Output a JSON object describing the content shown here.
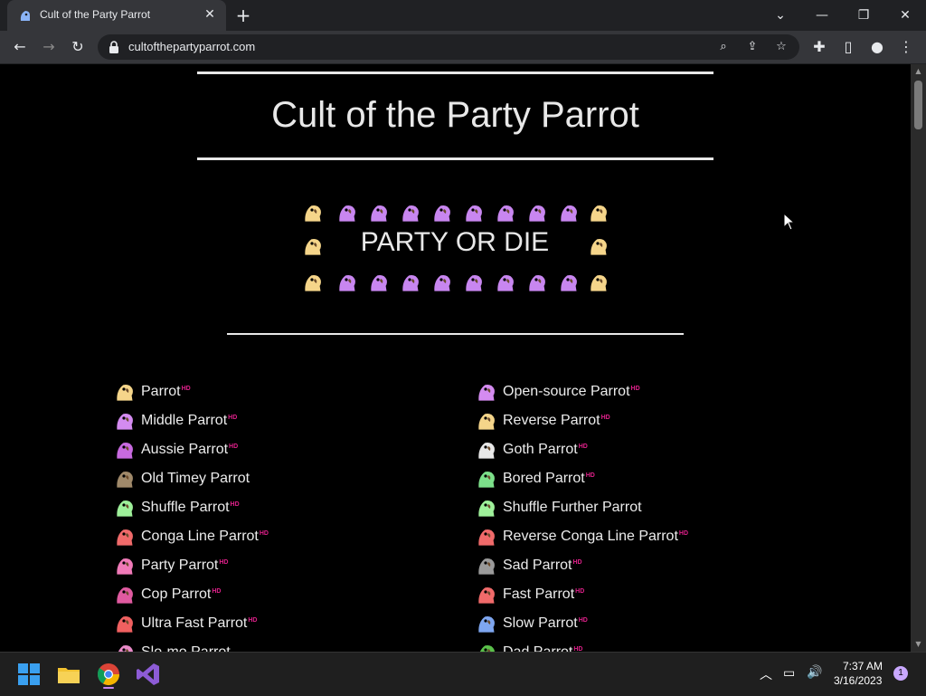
{
  "browser": {
    "tab_title": "Cult of the Party Parrot",
    "url": "cultofthepartyparrot.com"
  },
  "page": {
    "title": "Cult of the Party Parrot",
    "banner_text": "PARTY OR DIE",
    "hd_badge": "HD",
    "parrots_left": [
      {
        "label": "Parrot",
        "hd": true,
        "color": "#f5d58a"
      },
      {
        "label": "Middle Parrot",
        "hd": true,
        "color": "#d48bf0"
      },
      {
        "label": "Aussie Parrot",
        "hd": true,
        "color": "#c86ae0"
      },
      {
        "label": "Old Timey Parrot",
        "hd": false,
        "color": "#a0896a"
      },
      {
        "label": "Shuffle Parrot",
        "hd": true,
        "color": "#9ef09a"
      },
      {
        "label": "Conga Line Parrot",
        "hd": true,
        "color": "#f06a6a"
      },
      {
        "label": "Party Parrot",
        "hd": true,
        "color": "#f07ab8"
      },
      {
        "label": "Cop Parrot",
        "hd": true,
        "color": "#e05aa0"
      },
      {
        "label": "Ultra Fast Parrot",
        "hd": true,
        "color": "#f06060"
      },
      {
        "label": "Slo-mo Parrot",
        "hd": false,
        "color": "#e88ac8"
      }
    ],
    "parrots_right": [
      {
        "label": "Open-source Parrot",
        "hd": true,
        "color": "#d48bf0"
      },
      {
        "label": "Reverse Parrot",
        "hd": true,
        "color": "#f5d58a"
      },
      {
        "label": "Goth Parrot",
        "hd": true,
        "color": "#e8e8e8"
      },
      {
        "label": "Bored Parrot",
        "hd": true,
        "color": "#7ce08a"
      },
      {
        "label": "Shuffle Further Parrot",
        "hd": false,
        "color": "#9ef09a"
      },
      {
        "label": "Reverse Conga Line Parrot",
        "hd": true,
        "color": "#f06a6a"
      },
      {
        "label": "Sad Parrot",
        "hd": true,
        "color": "#9a9a9a"
      },
      {
        "label": "Fast Parrot",
        "hd": true,
        "color": "#f06a6a"
      },
      {
        "label": "Slow Parrot",
        "hd": true,
        "color": "#7ea6f0"
      },
      {
        "label": "Dad Parrot",
        "hd": true,
        "color": "#5ac04a"
      }
    ]
  },
  "taskbar": {
    "time": "7:37 AM",
    "date": "3/16/2023",
    "notification_count": "1"
  },
  "colors": {
    "parrot_gold": "#f5d58a",
    "parrot_purple": "#c886f0"
  }
}
